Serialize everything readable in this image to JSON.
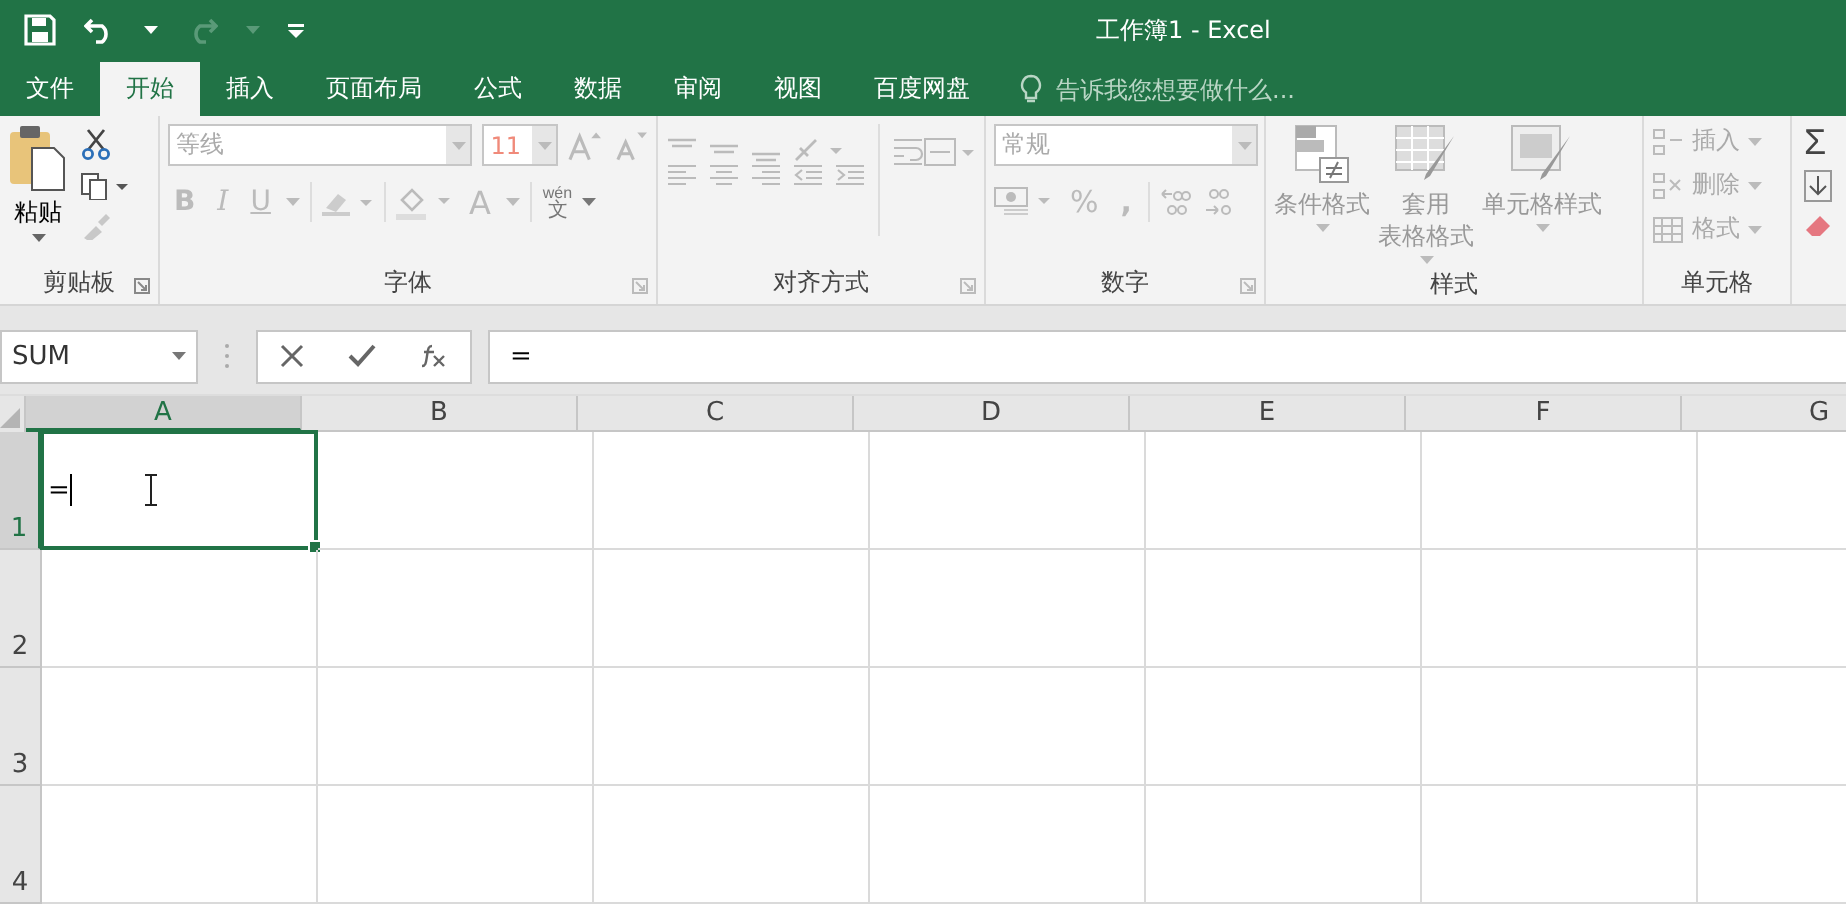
{
  "title_bar": {
    "title": "工作簿1 - Excel"
  },
  "tabs": [
    {
      "label": "文件",
      "selected": false
    },
    {
      "label": "开始",
      "selected": true
    },
    {
      "label": "插入",
      "selected": false
    },
    {
      "label": "页面布局",
      "selected": false
    },
    {
      "label": "公式",
      "selected": false
    },
    {
      "label": "数据",
      "selected": false
    },
    {
      "label": "审阅",
      "selected": false
    },
    {
      "label": "视图",
      "selected": false
    },
    {
      "label": "百度网盘",
      "selected": false
    }
  ],
  "tell_me": {
    "placeholder": "告诉我您想要做什么..."
  },
  "ribbon": {
    "clipboard": {
      "title": "剪贴板",
      "paste_label": "粘贴"
    },
    "font": {
      "title": "字体",
      "font_name": "等线",
      "font_size": "11",
      "bold_label": "B",
      "italic_label": "I",
      "underline_label": "U",
      "font_color_label": "A",
      "phonetic_label": "wén",
      "phonetic_char": "文"
    },
    "alignment": {
      "title": "对齐方式"
    },
    "number": {
      "title": "数字",
      "format": "常规",
      "percent_label": "%",
      "comma_label": ","
    },
    "styles": {
      "title": "样式",
      "buttons": [
        {
          "lines": [
            "条件格式"
          ],
          "kind": "conditional"
        },
        {
          "lines": [
            "套用",
            "表格格式"
          ],
          "kind": "table"
        },
        {
          "lines": [
            "单元格样式"
          ],
          "kind": "cellstyle"
        }
      ]
    },
    "cells": {
      "title": "单元格",
      "items": [
        {
          "label": "插入",
          "kind": "insert"
        },
        {
          "label": "删除",
          "kind": "delete"
        },
        {
          "label": "格式",
          "kind": "format"
        }
      ]
    },
    "editing": {
      "sum_label": "Σ"
    }
  },
  "formula_bar": {
    "name_box": "SUM",
    "formula": "="
  },
  "sheet": {
    "columns": [
      {
        "label": "A",
        "selected": true
      },
      {
        "label": "B",
        "selected": false
      },
      {
        "label": "C",
        "selected": false
      },
      {
        "label": "D",
        "selected": false
      },
      {
        "label": "E",
        "selected": false
      },
      {
        "label": "F",
        "selected": false
      },
      {
        "label": "G",
        "selected": false
      }
    ],
    "rows": [
      {
        "label": "1",
        "selected": true
      },
      {
        "label": "2",
        "selected": false
      },
      {
        "label": "3",
        "selected": false
      },
      {
        "label": "4",
        "selected": false
      }
    ],
    "active_cell": {
      "value": "="
    }
  }
}
